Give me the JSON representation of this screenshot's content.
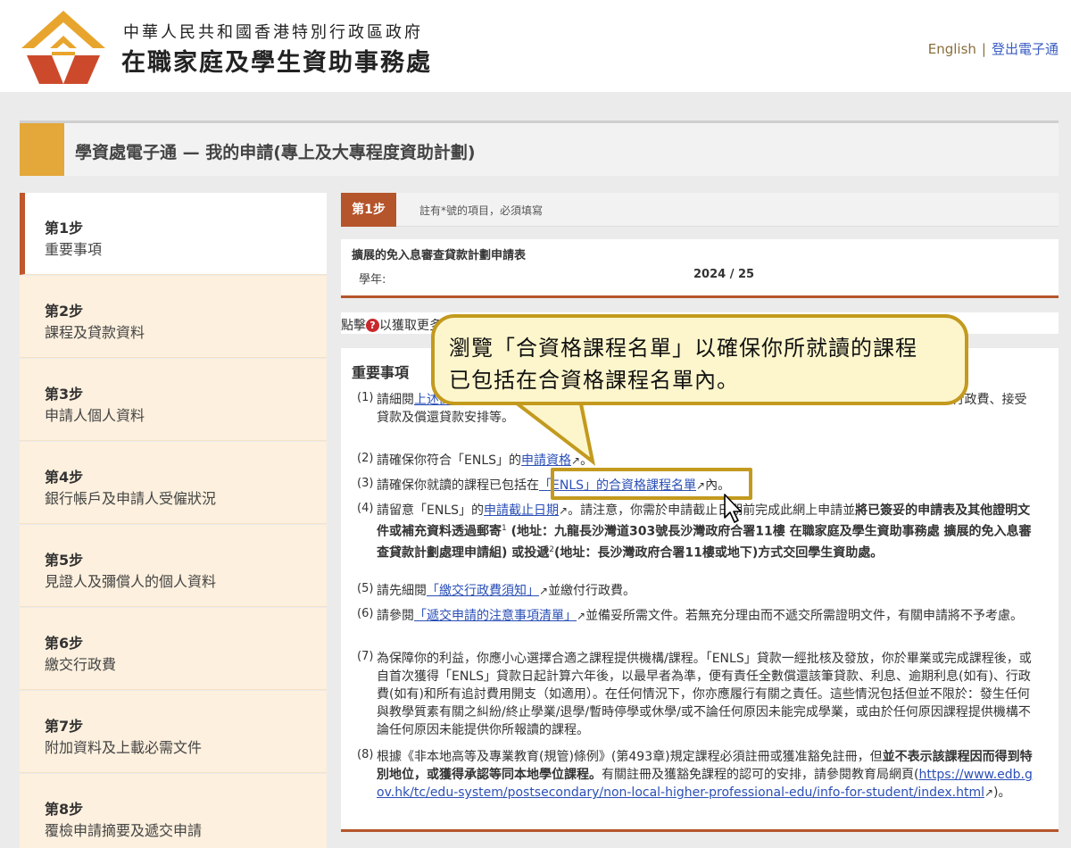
{
  "header": {
    "gov_name": "中華人民共和國香港特別行政區政府",
    "agency_name": "在職家庭及學生資助事務處",
    "lang_link": "English",
    "separator": "|",
    "logout_link": "登出電子通"
  },
  "title_bar": {
    "title": "學資處電子通 — 我的申請(專上及大專程度資助計劃)"
  },
  "sidebar": {
    "steps": [
      {
        "num": "第1步",
        "label": "重要事項"
      },
      {
        "num": "第2步",
        "label": "課程及貸款資料"
      },
      {
        "num": "第3步",
        "label": "申請人個人資料"
      },
      {
        "num": "第4步",
        "label": "銀行帳戶及申請人受僱狀況"
      },
      {
        "num": "第5步",
        "label": "見證人及彌償人的個人資料"
      },
      {
        "num": "第6步",
        "label": "繳交行政費"
      },
      {
        "num": "第7步",
        "label": "附加資料及上載必需文件"
      },
      {
        "num": "第8步",
        "label": "覆檢申請摘要及遞交申請"
      }
    ]
  },
  "step_header": {
    "tag": "第1步",
    "note": "註有*號的項目，必須填寫"
  },
  "form": {
    "title": "擴展的免入息審查貸款計劃申請表",
    "year_label": "學年:",
    "year_value": "2024 / 25"
  },
  "hint": {
    "prefix": "點擊",
    "icon": "?",
    "suffix": "以獲取更多資料"
  },
  "callout": {
    "line1": "瀏覽「合資格課程名單」以確保你所就讀的課程",
    "line2": "已包括在合資格課程名單內。"
  },
  "notes": {
    "heading": "重要事項",
    "ext_icon": "↗",
    "items": [
      {
        "n": "(1)",
        "a": "請細閱",
        "link": "上述計劃的申請指引",
        "b": "，以了解申請詳情、條款和條件，包括最高貸款額及終身貸款限額、利息及行政費、接受貸款及償還貸款安排等。"
      },
      {
        "n": "(2)",
        "a": "請確保你符合「ENLS」的",
        "link": "申請資格",
        "b": "。"
      },
      {
        "n": "(3)",
        "a": "請確保你就讀的課程已包括在",
        "link": "「ENLS」的合資格課程名單",
        "b": "內。"
      },
      {
        "n": "(4)",
        "a": "請留意「ENLS」的",
        "link": "申請截止日期",
        "b1": "。請注意，你需於申請截止日期前完成此網上申請並",
        "bold1": "將已簽妥的申請表及其他證明文件或補充資料透過郵寄",
        "sup1": "1",
        "bold2": " (地址：九龍長沙灣道303號長沙灣政府合署11樓 在職家庭及學生資助事務處 擴展的免入息審查貸款計劃處理申請組) 或投遞",
        "sup2": "2",
        "bold3": "(地址：長沙灣政府合署11樓或地下)方式交回學生資助處。"
      },
      {
        "n": "(5)",
        "a": "請先細閱",
        "link": "「繳交行政費須知」",
        "b": "並繳付行政費。"
      },
      {
        "n": "(6)",
        "a": "請參閱",
        "link": "「遞交申請的注意事項清單」",
        "b": "並備妥所需文件。若無充分理由而不遞交所需證明文件，有關申請將不予考慮。"
      },
      {
        "n": "(7)",
        "text": "為保障你的利益，你應小心選擇合適之課程提供機構/課程。「ENLS」貸款一經批核及發放，你於畢業或完成課程後，或自首次獲得「ENLS」貸款日起計算六年後，以最早者為準，便有責任全數償還該筆貸款、利息、逾期利息(如有)、行政費(如有)和所有追討費用開支（如適用）。在任何情況下，你亦應履行有關之責任。這些情況包括但並不限於：發生任何與教學質素有關之糾紛/終止學業/退學/暫時停學或休學/或不論任何原因未能完成學業，或由於任何原因課程提供機構不論任何原因未能提供你所報讀的課程。"
      },
      {
        "n": "(8)",
        "a": "根據《非本地高等及專業教育(規管)條例》(第493章)規定課程必須註冊或獲准豁免註冊，但",
        "bold": "並不表示該課程因而得到特別地位，或獲得承認等同本地學位課程。",
        "b": "有關註冊及獲豁免課程的認可的安排，請參閱教育局網頁(",
        "link": "https://www.edb.gov.hk/tc/edu-system/postsecondary/non-local-higher-professional-edu/info-for-student/index.html",
        "c": ")。"
      }
    ]
  },
  "colors": {
    "accent": "#e4a83a",
    "step_red": "#b5552b",
    "callout_border": "#c39a1e",
    "link": "#2a4fb6"
  }
}
